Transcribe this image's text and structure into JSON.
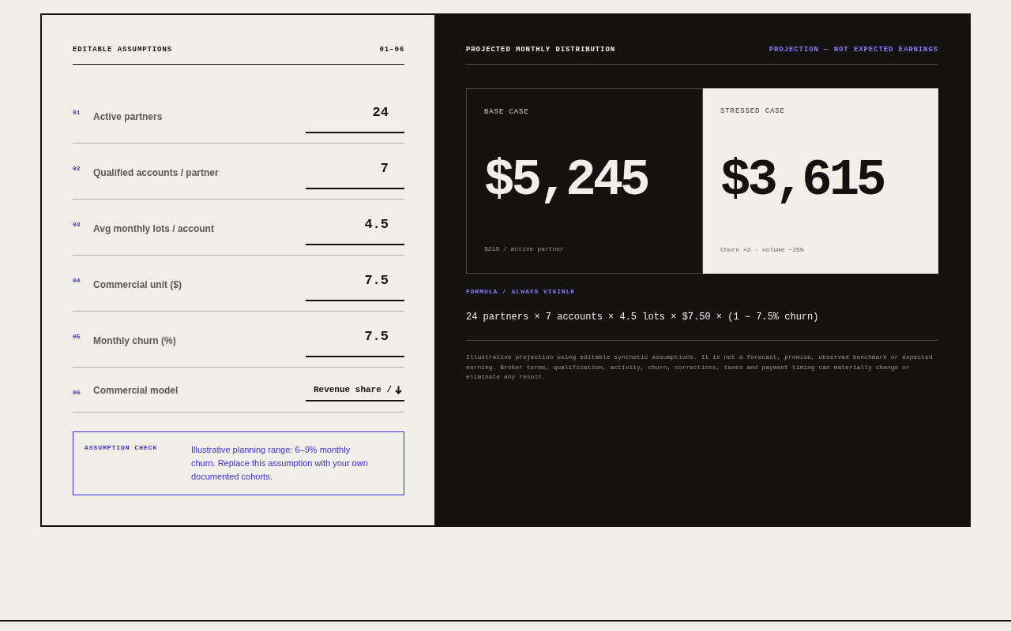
{
  "assumptions": {
    "title": "EDITABLE ASSUMPTIONS",
    "range": "01–06",
    "rows": [
      {
        "number": "01",
        "label": "Active partners",
        "kind": "input",
        "value": "24"
      },
      {
        "number": "02",
        "label": "Qualified accounts / partner",
        "kind": "input",
        "value": "7"
      },
      {
        "number": "03",
        "label": "Avg monthly lots / account",
        "kind": "input",
        "value": "4.5"
      },
      {
        "number": "04",
        "label": "Commercial unit ($)",
        "kind": "input",
        "value": "7.5"
      },
      {
        "number": "05",
        "label": "Monthly churn (%)",
        "kind": "input",
        "value": "7.5"
      },
      {
        "number": "06",
        "label": "Commercial model",
        "kind": "select",
        "value": "Revenue share /"
      }
    ]
  },
  "assumption_check": {
    "label": "ASSUMPTION CHECK",
    "text": "Illustrative planning range: 6–9% monthly churn. Replace this assumption with your own documented cohorts."
  },
  "projection": {
    "title": "PROJECTED MONTHLY DISTRIBUTION",
    "note": "PROJECTION — NOT EXPECTED EARNINGS",
    "cases": [
      {
        "kind": "base",
        "label": "BASE CASE",
        "amount": "$5,245",
        "detail": "$219 / active partner"
      },
      {
        "kind": "stressed",
        "label": "STRESSED CASE",
        "amount": "$3,615",
        "detail": "Churn ×2 · volume −25%"
      }
    ],
    "formula_label": "FORMULA / ALWAYS VISIBLE",
    "formula": "24 partners × 7 accounts × 4.5 lots × $7.50 × (1 − 7.5% churn)",
    "disclaimer": "Illustrative projection using editable synthetic assumptions. It is not a forecast, promise, observed benchmark or expected earning. Broker terms, qualification, activity, churn, corrections, taxes and payment timing can materially change or eliminate any result."
  }
}
